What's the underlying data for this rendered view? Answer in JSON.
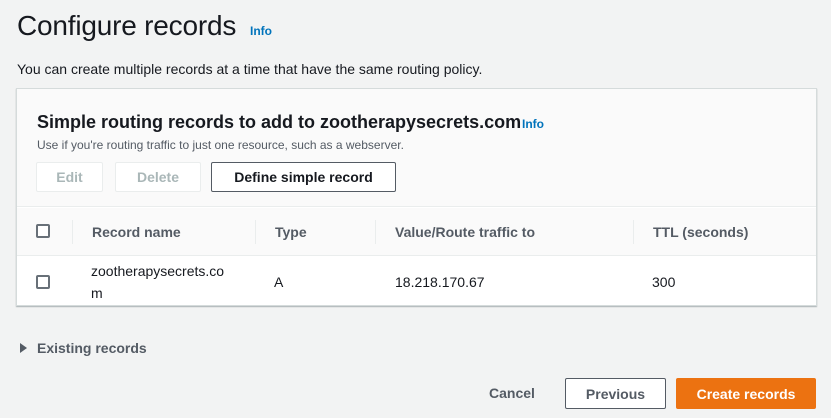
{
  "header": {
    "title": "Configure records",
    "info_label": "Info",
    "description": "You can create multiple records at a time that have the same routing policy."
  },
  "panel": {
    "title": "Simple routing records to add to zootherapysecrets.com",
    "info_label": "Info",
    "description": "Use if you're routing traffic to just one resource, such as a webserver.",
    "actions": {
      "edit_label": "Edit",
      "delete_label": "Delete",
      "define_label": "Define simple record"
    }
  },
  "table": {
    "columns": [
      "Record name",
      "Type",
      "Value/Route traffic to",
      "TTL (seconds)"
    ],
    "rows": [
      {
        "record_name_line1": "zootherapysecrets.co",
        "record_name_line2": "m",
        "type": "A",
        "value": "18.218.170.67",
        "ttl": "300"
      }
    ]
  },
  "existing_records": {
    "label": "Existing records"
  },
  "footer": {
    "cancel_label": "Cancel",
    "previous_label": "Previous",
    "create_label": "Create records"
  },
  "colors": {
    "accent": "#ec7211",
    "link": "#0073bb",
    "background": "#f2f3f3"
  }
}
